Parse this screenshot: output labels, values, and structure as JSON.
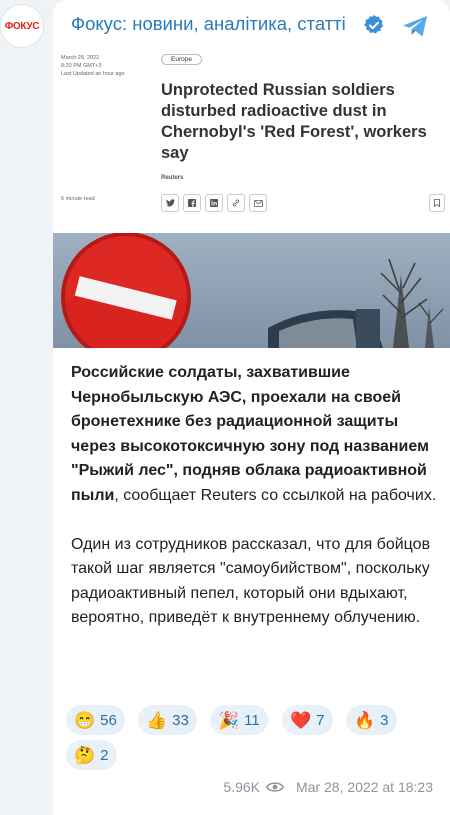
{
  "avatar": {
    "text": "ФОКУС"
  },
  "header": {
    "channel_name": "Фокус: новини, аналітика, статті"
  },
  "article": {
    "date": "March 28, 2022",
    "time": "8:20 PM GMT+3",
    "updated": "Last Updated an hour ago",
    "region": "Europe",
    "headline": "Unprotected Russian soldiers disturbed radioactive dust in Chernobyl's 'Red Forest', workers say",
    "source": "Reuters",
    "read_time": "6 minute read"
  },
  "post": {
    "bold_text": "Российские солдаты, захватившие Чернобыльскую АЭС, проехали на своей бронетехнике без радиационной защиты через высокотоксичную зону под названием \"Рыжий лес\", подняв облака радиоактивной пыли",
    "regular_text": ", сообщает Reuters со ссылкой на рабочих.",
    "paragraph2": "Один из сотрудников рассказал, что для бойцов такой шаг является \"самоубийством\", поскольку радиоактивный пепел, который они вдыхают, вероятно, приведёт к внутреннему облучению."
  },
  "reactions": [
    {
      "emoji": "😁",
      "count": "56"
    },
    {
      "emoji": "👍",
      "count": "33"
    },
    {
      "emoji": "🎉",
      "count": "11"
    },
    {
      "emoji": "❤️",
      "count": "7"
    },
    {
      "emoji": "🔥",
      "count": "3"
    },
    {
      "emoji": "🤔",
      "count": "2"
    }
  ],
  "footer": {
    "views": "5.96K",
    "timestamp": "Mar 28, 2022 at 18:23"
  },
  "colors": {
    "accent": "#2a7ab8",
    "reaction_bg": "#e8f0f8",
    "verified": "#3a8fd6"
  }
}
